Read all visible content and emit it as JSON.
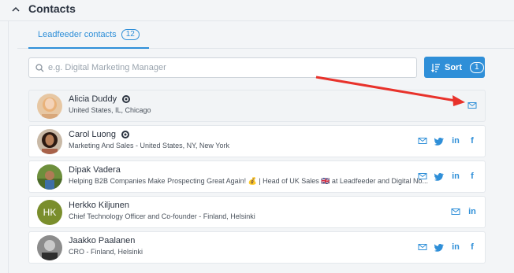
{
  "section": {
    "title": "Contacts"
  },
  "tabs": [
    {
      "label": "Leadfeeder contacts",
      "count": "12"
    }
  ],
  "search": {
    "placeholder": "e.g. Digital Marketing Manager",
    "value": ""
  },
  "sort": {
    "label": "Sort",
    "count": "1"
  },
  "contacts": [
    {
      "name": "Alicia Duddy",
      "subtitle": "United States, IL, Chicago",
      "badge": "mailchimp-icon"
    },
    {
      "name": "Carol Luong",
      "subtitle": "Marketing And Sales - United States, NY, New York",
      "badge": "mailchimp-icon"
    },
    {
      "name": "Dipak Vadera",
      "subtitle": "Helping B2B Companies Make Prospecting Great Again! 💰 | Head of UK Sales 🇬🇧 at Leadfeeder and Digital No..."
    },
    {
      "name": "Herkko Kiljunen",
      "initials": "HK",
      "subtitle": "Chief Technology Officer and Co-founder - Finland, Helsinki"
    },
    {
      "name": "Jaakko Paalanen",
      "subtitle": "CRO - Finland, Helsinki"
    }
  ],
  "social_labels": {
    "linkedin": "in",
    "facebook": "f"
  },
  "colors": {
    "accent": "#2f8fd8",
    "annotation_arrow": "#e8322b",
    "avatar_hk": "#7a8e2c"
  }
}
